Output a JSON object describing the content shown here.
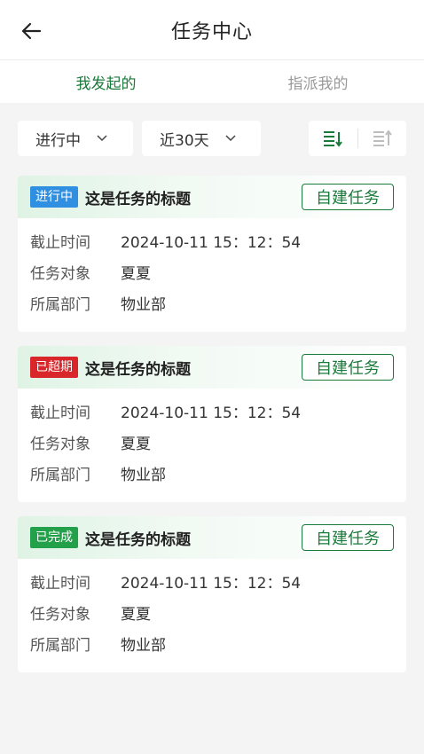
{
  "header": {
    "title": "任务中心",
    "back_icon": "arrow-left-icon"
  },
  "tabs": [
    {
      "label": "我发起的",
      "active": true
    },
    {
      "label": "指派我的",
      "active": false
    }
  ],
  "filters": {
    "status_value": "进行中",
    "range_value": "近30天"
  },
  "colors": {
    "accent": "#1a7a3a",
    "in_progress": "#2f8fe0",
    "overdue": "#d8262a",
    "done": "#23a04a"
  },
  "cards": [
    {
      "status": "进行中",
      "title": "这是任务的标题",
      "action": "自建任务",
      "deadline_label": "截止时间",
      "deadline": "2024-10-11 15：12：54",
      "target_label": "任务对象",
      "target": "夏夏",
      "dept_label": "所属部门",
      "dept": "物业部"
    },
    {
      "status": "已超期",
      "title": "这是任务的标题",
      "action": "自建任务",
      "deadline_label": "截止时间",
      "deadline": "2024-10-11 15：12：54",
      "target_label": "任务对象",
      "target": "夏夏",
      "dept_label": "所属部门",
      "dept": "物业部"
    },
    {
      "status": "已完成",
      "title": "这是任务的标题",
      "action": "自建任务",
      "deadline_label": "截止时间",
      "deadline": "2024-10-11 15：12：54",
      "target_label": "任务对象",
      "target": "夏夏",
      "dept_label": "所属部门",
      "dept": "物业部"
    }
  ]
}
